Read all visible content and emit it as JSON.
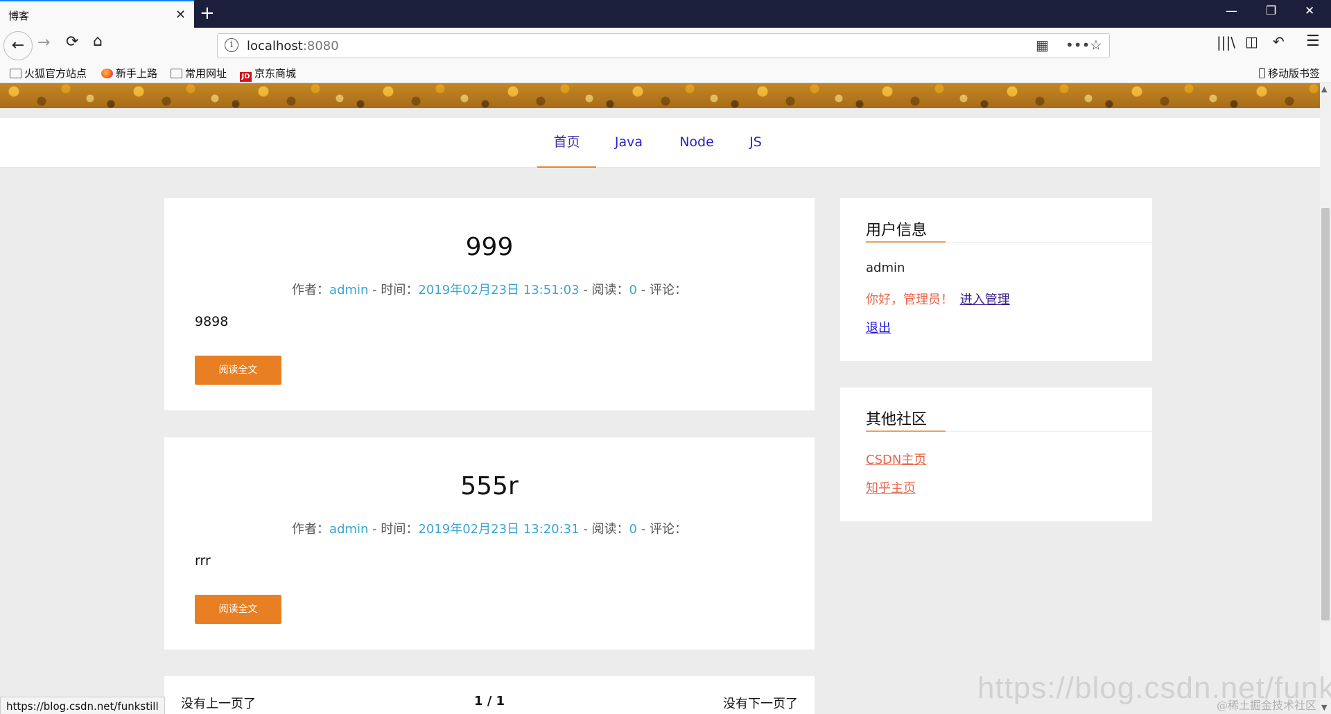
{
  "browser": {
    "tab_title": "博客",
    "url_host": "localhost",
    "url_port": ":8080",
    "bookmarks": [
      "火狐官方站点",
      "新手上路",
      "常用网址",
      "京东商城"
    ],
    "bookmark_jd_badge": "JD",
    "mobile_bookmarks": "移动版书签",
    "status_url": "https://blog.csdn.net/funkstill"
  },
  "nav": {
    "items": [
      "首页",
      "Java",
      "Node",
      "JS"
    ],
    "active": "首页"
  },
  "posts": [
    {
      "title": "999",
      "author_label": "作者：",
      "author": "admin",
      "time_label": " - 时间：",
      "time": "2019年02月23日 13:51:03",
      "read_label": " - 阅读：",
      "reads": "0",
      "comment_label": " - 评论：",
      "excerpt": "9898",
      "button": "阅读全文"
    },
    {
      "title": "555r",
      "author_label": "作者：",
      "author": "admin",
      "time_label": " - 时间：",
      "time": "2019年02月23日 13:20:31",
      "read_label": " - 阅读：",
      "reads": "0",
      "comment_label": " - 评论：",
      "excerpt": "rrr",
      "button": "阅读全文"
    }
  ],
  "pager": {
    "prev": "没有上一页了",
    "page": "1 / 1",
    "next": "没有下一页了"
  },
  "sidebar": {
    "user_title": "用户信息",
    "username": "admin",
    "greeting": "你好，管理员！",
    "admin_link": "进入管理",
    "logout": "退出",
    "community_title": "其他社区",
    "links": [
      "CSDN主页",
      "知乎主页"
    ]
  },
  "watermark": {
    "main": "https://blog.csdn.net/funkstill",
    "sub": "@稀土掘金技术社区"
  },
  "colors": {
    "accent_orange": "#e87f22",
    "link_blue": "#39a6d6",
    "nav_blue": "#2622c8",
    "greeting_red": "#e8664b"
  }
}
